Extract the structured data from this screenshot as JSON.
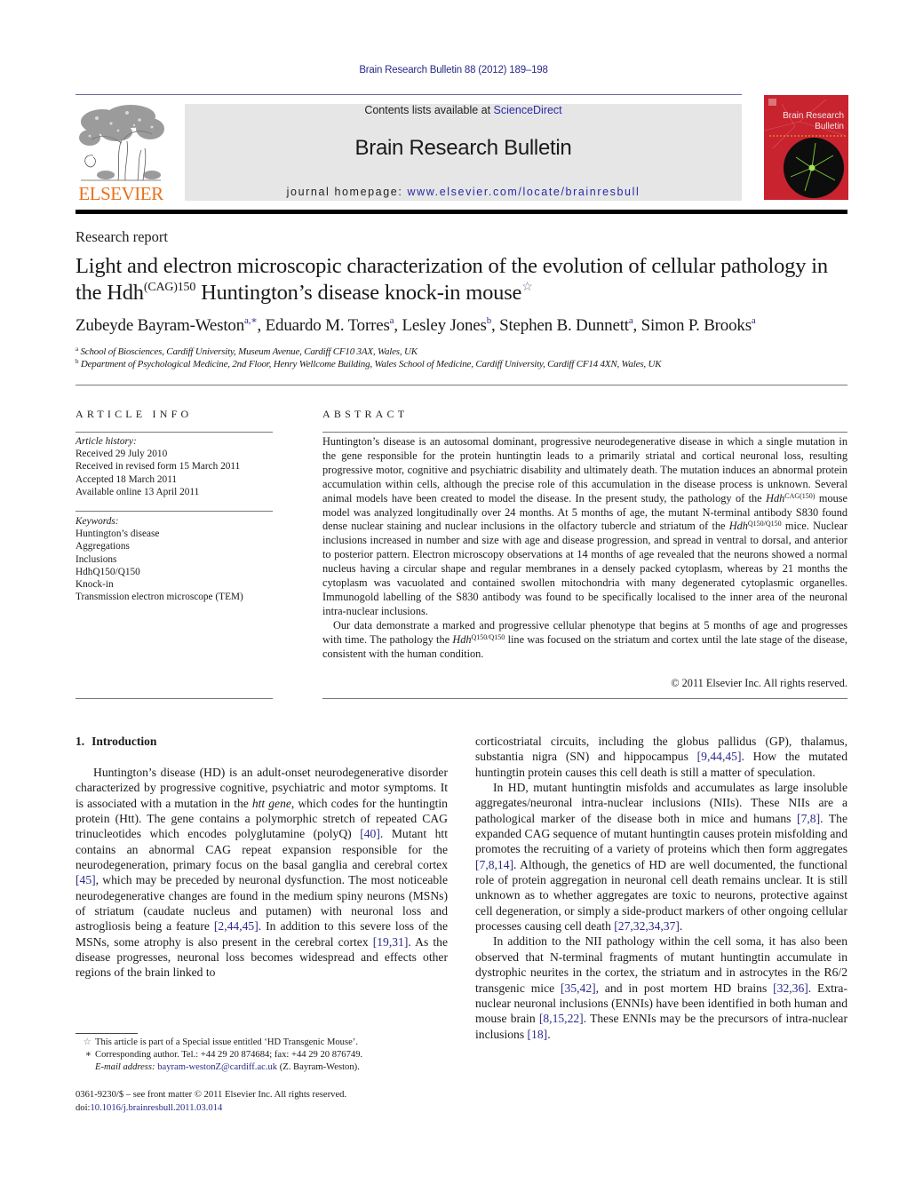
{
  "header": {
    "journal_citation": "Brain Research Bulletin 88 (2012) 189–198",
    "contents_prefix": "Contents lists available at ",
    "contents_link": "ScienceDirect",
    "journal_title": "Brain Research Bulletin",
    "homepage_prefix": "journal homepage: ",
    "homepage_url": "www.elsevier.com/locate/brainresbull",
    "publisher_wordmark": "ELSEVIER",
    "cover_title_line1": "Brain Research",
    "cover_title_line2": "Bulletin",
    "colors": {
      "link": "#2a2a8a",
      "publisher_orange": "#e9711c",
      "cover_red": "#c8232f",
      "masthead_gray": "#e6e6e6"
    }
  },
  "article": {
    "type": "Research report",
    "title_part1": "Light and electron microscopic characterization of the evolution of cellular pathology in the Hdh",
    "title_sup": "(CAG)150",
    "title_part2": " Huntington’s disease knock-in mouse",
    "title_note_mark": "☆",
    "authors": [
      {
        "name": "Zubeyde Bayram-Weston",
        "marks": "a,∗",
        "sep": ", "
      },
      {
        "name": "Eduardo M. Torres",
        "marks": "a",
        "sep": ", "
      },
      {
        "name": "Lesley Jones",
        "marks": "b",
        "sep": ", "
      },
      {
        "name": "Stephen B. Dunnett",
        "marks": "a",
        "sep": ", "
      },
      {
        "name": "Simon P. Brooks",
        "marks": "a",
        "sep": ""
      }
    ],
    "affiliations": [
      {
        "mark": "a",
        "text": "School of Biosciences, Cardiff University, Museum Avenue, Cardiff CF10 3AX, Wales, UK"
      },
      {
        "mark": "b",
        "text": "Department of Psychological Medicine, 2nd Floor, Henry Wellcome Building, Wales School of Medicine, Cardiff University, Cardiff CF14 4XN, Wales, UK"
      }
    ]
  },
  "article_info": {
    "heading": "ARTICLE INFO",
    "history_label": "Article history:",
    "history": [
      "Received 29 July 2010",
      "Received in revised form 15 March 2011",
      "Accepted 18 March 2011",
      "Available online 13 April 2011"
    ],
    "keywords_label": "Keywords:",
    "keywords": [
      "Huntington’s disease",
      "Aggregations",
      "Inclusions",
      "HdhQ150/Q150",
      "Knock-in",
      "Transmission electron microscope (TEM)"
    ]
  },
  "abstract": {
    "heading": "ABSTRACT",
    "p1_a": "Huntington’s disease is an autosomal dominant, progressive neurodegenerative disease in which a single mutation in the gene responsible for the protein huntingtin leads to a primarily striatal and cortical neuronal loss, resulting progressive motor, cognitive and psychiatric disability and ultimately death. The mutation induces an abnormal protein accumulation within cells, although the precise role of this accumulation in the disease process is unknown. Several animal models have been created to model the disease. In the present study, the pathology of the ",
    "p1_gene1": "Hdh",
    "p1_gene1_sup": "CAG(150)",
    "p1_b": " mouse model was analyzed longitudinally over 24 months. At 5 months of age, the mutant N-terminal antibody S830 found dense nuclear staining and nuclear inclusions in the olfactory tubercle and striatum of the ",
    "p1_gene2": "Hdh",
    "p1_gene2_sup": "Q150/Q150",
    "p1_c": " mice. Nuclear inclusions increased in number and size with age and disease progression, and spread in ventral to dorsal, and anterior to posterior pattern. Electron microscopy observations at 14 months of age revealed that the neurons showed a normal nucleus having a circular shape and regular membranes in a densely packed cytoplasm, whereas by 21 months the cytoplasm was vacuolated and contained swollen mitochondria with many degenerated cytoplasmic organelles. Immunogold labelling of the S830 antibody was found to be specifically localised to the inner area of the neuronal intra-nuclear inclusions.",
    "p2_a": "Our data demonstrate a marked and progressive cellular phenotype that begins at 5 months of age and progresses with time. The pathology the ",
    "p2_gene": "Hdh",
    "p2_gene_sup": "Q150/Q150",
    "p2_b": " line was focused on the striatum and cortex until the late stage of the disease, consistent with the human condition.",
    "copyright": "© 2011 Elsevier Inc. All rights reserved."
  },
  "introduction": {
    "number": "1.",
    "heading": "Introduction",
    "left": {
      "t1": "Huntington’s disease (HD) is an adult-onset neurodegenerative disorder characterized by progressive cognitive, psychiatric and motor symptoms. It is associated with a mutation in the ",
      "t1_italic": "htt gene",
      "t2": ", which codes for the huntingtin protein (Htt). The gene contains a polymorphic stretch of repeated CAG trinucleotides which encodes polyglutamine (polyQ) ",
      "ref1": "[40]",
      "t3": ". Mutant htt contains an abnormal CAG repeat expansion responsible for the neurodegeneration, primary focus on the basal ganglia and cerebral cortex ",
      "ref2": "[45]",
      "t4": ", which may be preceded by neuronal dysfunction. The most noticeable neurodegenerative changes are found in the medium spiny neurons (MSNs) of striatum (caudate nucleus and putamen) with neuronal loss and astrogliosis being a feature ",
      "ref3": "[2,44,45]",
      "t5": ". In addition to this severe loss of the MSNs, some atrophy is also present in the cerebral cortex ",
      "ref4": "[19,31]",
      "t6": ". As the disease progresses, neuronal loss becomes widespread and effects other regions of the brain linked to"
    },
    "right": {
      "p1_a": "corticostriatal circuits, including the globus pallidus (GP), thalamus, substantia nigra (SN) and hippocampus ",
      "p1_ref": "[9,44,45]",
      "p1_b": ". How the mutated huntingtin protein causes this cell death is still a matter of speculation.",
      "p2_a": "In HD, mutant huntingtin misfolds and accumulates as large insoluble aggregates/neuronal intra-nuclear inclusions (NIIs). These NIIs are a pathological marker of the disease both in mice and humans ",
      "p2_ref1": "[7,8]",
      "p2_b": ". The expanded CAG sequence of mutant huntingtin causes protein misfolding and promotes the recruiting of a variety of proteins which then form aggregates ",
      "p2_ref2": "[7,8,14]",
      "p2_c": ". Although, the genetics of HD are well documented, the functional role of protein aggregation in neuronal cell death remains unclear. It is still unknown as to whether aggregates are toxic to neurons, protective against cell degeneration, or simply a side-product markers of other ongoing cellular processes causing cell death ",
      "p2_ref3": "[27,32,34,37]",
      "p2_d": ".",
      "p3_a": "In addition to the NII pathology within the cell soma, it has also been observed that N-terminal fragments of mutant huntingtin accumulate in dystrophic neurites in the cortex, the striatum and in astrocytes in the R6/2 transgenic mice ",
      "p3_ref1": "[35,42]",
      "p3_b": ", and in post mortem HD brains ",
      "p3_ref2": "[32,36]",
      "p3_c": ". Extra-nuclear neuronal inclusions (ENNIs) have been identified in both human and mouse brain ",
      "p3_ref3": "[8,15,22]",
      "p3_d": ". These ENNIs may be the precursors of intra-nuclear inclusions ",
      "p3_ref4": "[18]",
      "p3_e": "."
    }
  },
  "footnotes": {
    "star_mark": "☆",
    "star_text": "This article is part of a Special issue entitled ‘HD Transgenic Mouse’.",
    "corr_mark": "∗",
    "corr_text": "Corresponding author. Tel.: +44 29 20 874684; fax: +44 29 20 876749.",
    "email_label": "E-mail address: ",
    "email": "bayram-westonZ@cardiff.ac.uk",
    "email_suffix": " (Z. Bayram-Weston).",
    "front_matter": "0361-9230/$ – see front matter © 2011 Elsevier Inc. All rights reserved.",
    "doi_prefix": "doi:",
    "doi": "10.1016/j.brainresbull.2011.03.014"
  }
}
